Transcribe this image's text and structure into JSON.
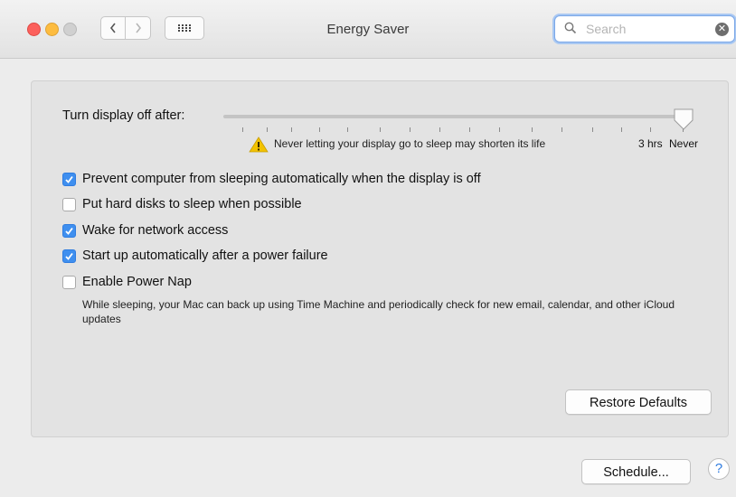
{
  "window": {
    "title": "Energy Saver",
    "search": {
      "placeholder": "Search",
      "value": ""
    }
  },
  "display_sleep": {
    "label": "Turn display off after:",
    "selected": "Never",
    "warning": "Never letting your display go to sleep may shorten its life",
    "tick_labels": [
      "3 hrs",
      "Never"
    ]
  },
  "options": [
    {
      "label": "Prevent computer from sleeping automatically when the display is off",
      "checked": true
    },
    {
      "label": "Put hard disks to sleep when possible",
      "checked": false
    },
    {
      "label": "Wake for network access",
      "checked": true
    },
    {
      "label": "Start up automatically after a power failure",
      "checked": true
    },
    {
      "label": "Enable Power Nap",
      "checked": false
    }
  ],
  "power_nap_description": "While sleeping, your Mac can back up using Time Machine and periodically check for new email, calendar, and other iCloud updates",
  "buttons": {
    "restore_defaults": "Restore Defaults",
    "schedule": "Schedule...",
    "help": "?"
  },
  "icons": {
    "close": "close-icon",
    "minimize": "minimize-icon",
    "zoom": "zoom-icon",
    "back": "chevron-left-icon",
    "forward": "chevron-right-icon",
    "show_all": "grid-icon",
    "search": "search-icon",
    "clear": "clear-icon",
    "warning": "warning-icon"
  },
  "colors": {
    "accent": "#3f8fef",
    "warning": "#f2c200"
  }
}
